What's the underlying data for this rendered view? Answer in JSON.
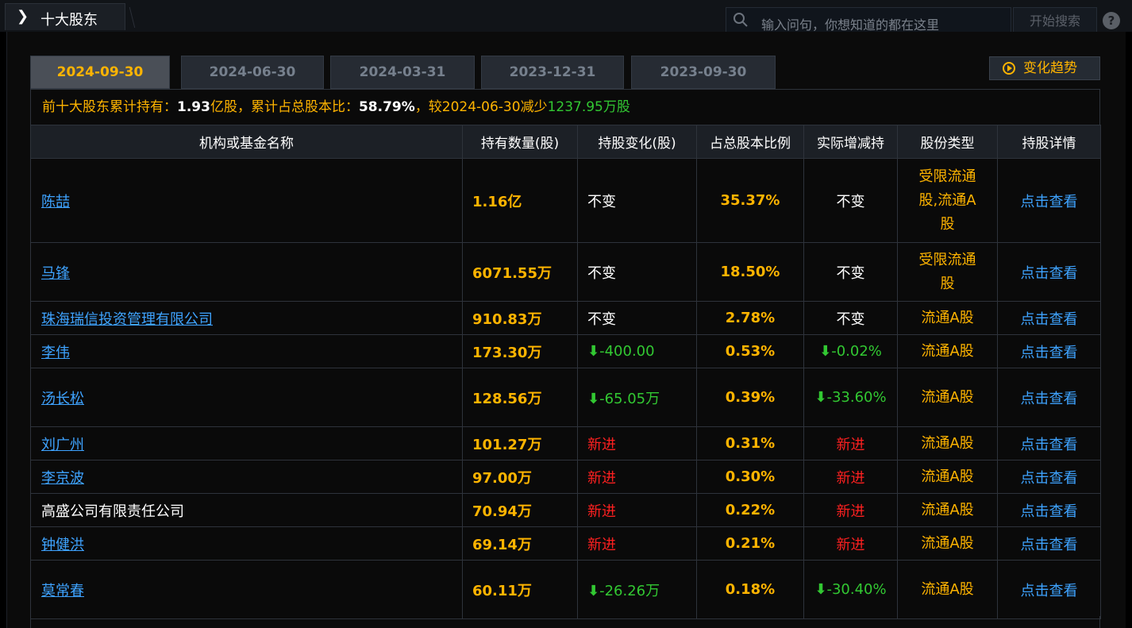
{
  "header": {
    "section_title": "十大股东",
    "search_placeholder": "输入问句，你想知道的都在这里",
    "search_button": "开始搜索",
    "help": "?"
  },
  "tabs": [
    {
      "label": "2024-09-30",
      "active": true
    },
    {
      "label": "2024-06-30",
      "active": false
    },
    {
      "label": "2024-03-31",
      "active": false
    },
    {
      "label": "2023-12-31",
      "active": false
    },
    {
      "label": "2023-09-30",
      "active": false
    }
  ],
  "trend_button": "变化趋势",
  "summary": {
    "label1": "前十大股东累计持有：",
    "value1": "1.93",
    "label2": "亿股，累计占总股本比：",
    "value2": "58.79%",
    "label3": "，较",
    "value3": "2024-06-30",
    "label4": "减少",
    "value4": "1237.95万股"
  },
  "table": {
    "headers": [
      "机构或基金名称",
      "持有数量(股)",
      "持股变化(股)",
      "占总股本比例",
      "实际增减持",
      "股份类型",
      "持股详情"
    ],
    "rows": [
      {
        "name": "陈喆",
        "link": true,
        "qty": "1.16亿",
        "chg": "不变",
        "chg_kind": "same",
        "pct": "35.37%",
        "act": "不变",
        "act_kind": "same",
        "type": "受限流通股,流通A股",
        "type_lines": [
          "受限流通",
          "股,流通A",
          "股"
        ],
        "detail": "点击查看"
      },
      {
        "name": "马锋",
        "link": true,
        "qty": "6071.55万",
        "chg": "不变",
        "chg_kind": "same",
        "pct": "18.50%",
        "act": "不变",
        "act_kind": "same",
        "type": "受限流通股",
        "type_lines": [
          "受限流通",
          "股"
        ],
        "detail": "点击查看"
      },
      {
        "name": "珠海瑞信投资管理有限公司",
        "link": true,
        "qty": "910.83万",
        "chg": "不变",
        "chg_kind": "same",
        "pct": "2.78%",
        "act": "不变",
        "act_kind": "same",
        "type": "流通A股",
        "type_lines": [
          "流通A股"
        ],
        "detail": "点击查看"
      },
      {
        "name": "李伟",
        "link": true,
        "qty": "173.30万",
        "chg": "-400.00",
        "chg_kind": "down",
        "pct": "0.53%",
        "act": "-0.02%",
        "act_kind": "down",
        "type": "流通A股",
        "type_lines": [
          "流通A股"
        ],
        "detail": "点击查看"
      },
      {
        "name": "汤长松",
        "link": true,
        "qty": "128.56万",
        "chg": "-65.05万",
        "chg_kind": "down",
        "pct": "0.39%",
        "act": "-33.60%",
        "act_kind": "down",
        "type": "流通A股",
        "type_lines": [
          "流通A股"
        ],
        "detail": "点击查看"
      },
      {
        "name": "刘广州",
        "link": true,
        "qty": "101.27万",
        "chg": "新进",
        "chg_kind": "new",
        "pct": "0.31%",
        "act": "新进",
        "act_kind": "new",
        "type": "流通A股",
        "type_lines": [
          "流通A股"
        ],
        "detail": "点击查看"
      },
      {
        "name": "李京波",
        "link": true,
        "qty": "97.00万",
        "chg": "新进",
        "chg_kind": "new",
        "pct": "0.30%",
        "act": "新进",
        "act_kind": "new",
        "type": "流通A股",
        "type_lines": [
          "流通A股"
        ],
        "detail": "点击查看"
      },
      {
        "name": "高盛公司有限责任公司",
        "link": false,
        "qty": "70.94万",
        "chg": "新进",
        "chg_kind": "new",
        "pct": "0.22%",
        "act": "新进",
        "act_kind": "new",
        "type": "流通A股",
        "type_lines": [
          "流通A股"
        ],
        "detail": "点击查看"
      },
      {
        "name": "钟健洪",
        "link": true,
        "qty": "69.14万",
        "chg": "新进",
        "chg_kind": "new",
        "pct": "0.21%",
        "act": "新进",
        "act_kind": "new",
        "type": "流通A股",
        "type_lines": [
          "流通A股"
        ],
        "detail": "点击查看"
      },
      {
        "name": "莫常春",
        "link": true,
        "qty": "60.11万",
        "chg": "-26.26万",
        "chg_kind": "down",
        "pct": "0.18%",
        "act": "-30.40%",
        "act_kind": "down",
        "type": "流通A股",
        "type_lines": [
          "流通A股"
        ],
        "detail": "点击查看"
      }
    ]
  },
  "colors": {
    "accent": "#ffb400",
    "link": "#3ea3ff",
    "up_new": "#ff2020",
    "down": "#32c832"
  }
}
